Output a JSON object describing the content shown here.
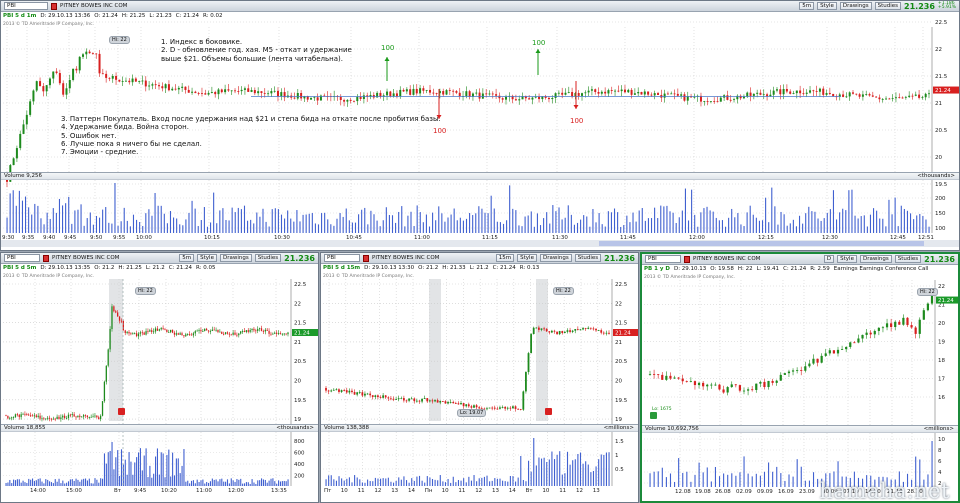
{
  "main": {
    "symbol": "PBI",
    "company": "PITNEY BOWES INC COM",
    "interval_btn": "5m",
    "style_btn": "Style",
    "drawings_btn": "Drawings",
    "studies_btn": "Studies",
    "last": "21.236",
    "change": "+1.186",
    "change_pct": "+5.91%",
    "info": {
      "label": "PBI 5 d 1m",
      "date": "D: 29.10.13 13:36",
      "open": "O: 21.24",
      "high": "H: 21.25",
      "low": "L: 21.23",
      "close": "C: 21.24",
      "range": "R: 0.02"
    },
    "copyright": "2013 © TD Ameritrade IP Company, Inc.",
    "hi_label": "Hi: 22",
    "price_tag": "21.24",
    "notes_top": [
      "1. Индекс в боковике.",
      "2. D - обновление год. хая. M5 - откат и удержание",
      "выше $21. Объемы большие (лента читабельна)."
    ],
    "notes_bottom": [
      "3. Паттерн Покупатель. Вход после удержания над $21 и степа бида на откате после пробития базы.",
      "4. Удержание бида. Война сторон.",
      "5. Ошибок нет.",
      "6. Лучше пока я ничего бы не сделал.",
      "7. Эмоции - средние."
    ],
    "arrows": {
      "up1": "100",
      "up2": "100",
      "down1": "100",
      "down2": "100"
    },
    "volume_label": "Volume",
    "volume_value": "9,256",
    "volume_units": "<thousands>",
    "y_ticks": [
      "22.5",
      "22",
      "21.5",
      "21",
      "20.5",
      "20",
      "19.5"
    ],
    "vol_ticks": [
      "200",
      "150",
      "100"
    ],
    "x_ticks": [
      "9:30",
      "9:35",
      "9:40",
      "9:45",
      "9:50",
      "9:55",
      "10:00",
      "10:15",
      "10:30",
      "10:45",
      "11:00",
      "11:15",
      "11:30",
      "11:45",
      "12:00",
      "12:15",
      "12:30",
      "12:45",
      "12:51"
    ]
  },
  "bl": {
    "symbol": "PBI",
    "company": "PITNEY BOWES INC COM",
    "interval_btn": "5m",
    "style_btn": "Style",
    "drawings_btn": "Drawings",
    "studies_btn": "Studies",
    "last": "21.236",
    "change": "+1.186",
    "change_pct": "+5.91%",
    "info": {
      "label": "PBI 5 d 5m",
      "date": "D: 29.10.13 13:35",
      "open": "O: 21.2",
      "high": "H: 21.25",
      "low": "L: 21.2",
      "close": "C: 21.24",
      "range": "R: 0.05"
    },
    "copyright": "2013 © TD Ameritrade IP Company, Inc.",
    "hi_label": "Hi: 22",
    "price_tag": "21.24",
    "volume_label": "Volume",
    "volume_value": "18,855",
    "volume_units": "<thousands>",
    "y_ticks": [
      "22.5",
      "22",
      "21.5",
      "21",
      "20.5",
      "20",
      "19.5",
      "19"
    ],
    "vol_ticks": [
      "800",
      "600",
      "400",
      "200"
    ],
    "x_ticks": [
      "14:00",
      "15:00",
      "Вт",
      "9:45",
      "10:20",
      "11:00",
      "12:00",
      "13:35"
    ]
  },
  "bm": {
    "symbol": "PBI",
    "company": "PITNEY BOWES INC COM",
    "interval_btn": "15m",
    "style_btn": "Style",
    "drawings_btn": "Drawings",
    "studies_btn": "Studies",
    "last": "21.236",
    "change": "+1.186",
    "change_pct": "+5.91%",
    "info": {
      "label": "PBI 5 d 15m",
      "date": "D: 29.10.13 13:30",
      "open": "O: 21.2",
      "high": "H: 21.33",
      "low": "L: 21.2",
      "close": "C: 21.24",
      "range": "R: 0.13"
    },
    "copyright": "2013 © TD Ameritrade IP Company, Inc.",
    "hi_label": "Hi: 22",
    "lo_label": "Lo: 19.07",
    "price_tag": "21.24",
    "volume_label": "Volume",
    "volume_value": "138,388",
    "volume_units": "<millions>",
    "y_ticks": [
      "22.5",
      "22",
      "21.5",
      "21",
      "20.5",
      "20",
      "19.5",
      "19"
    ],
    "vol_ticks": [
      "1.5",
      "1",
      "0.5"
    ],
    "x_ticks": [
      "Пт",
      "10",
      "11",
      "12",
      "13",
      "14",
      "Пн",
      "10",
      "11",
      "12",
      "13",
      "14",
      "Вт",
      "10",
      "11",
      "12",
      "13"
    ]
  },
  "br": {
    "symbol": "PBI",
    "company": "PITNEY BOWES INC COM",
    "interval_btn": "D",
    "style_btn": "Style",
    "drawings_btn": "Drawings",
    "studies_btn": "Studies",
    "last": "21.236",
    "change": "+1.186",
    "change_pct": "+5.91%",
    "info": {
      "label": "PB 1 y D",
      "date": "D: 29.10.13",
      "open": "O: 19.58",
      "high": "H: 22",
      "low": "L: 19.41",
      "close": "C: 21.24",
      "range": "R: 2.59",
      "earnings": "Earnings Earnings Conference Call"
    },
    "copyright": "2013 © TD Ameritrade IP Company, Inc.",
    "hi_label": "Hi: 22",
    "lo_label": "Lo: 1675",
    "price_tag": "21.24",
    "volume_label": "Volume",
    "volume_value": "10,692,756",
    "volume_units": "<millions>",
    "y_ticks": [
      "22",
      "21",
      "20",
      "19",
      "18",
      "17",
      "16"
    ],
    "vol_ticks": [
      "10",
      "8",
      "6",
      "4",
      "2"
    ],
    "x_ticks": [
      "12.08",
      "19.08",
      "26.08",
      "02.09",
      "09.09",
      "16.09",
      "23.09",
      "30.09",
      "07.10",
      "14.10",
      "21.10",
      "28.10"
    ]
  },
  "watermark": "hamaha.net",
  "colors": {
    "up": "#1d8a1d",
    "down": "#d81f1f",
    "volume": "#4060d0",
    "price_tag": "#d82020",
    "accent_green": "#1a9a1a"
  }
}
